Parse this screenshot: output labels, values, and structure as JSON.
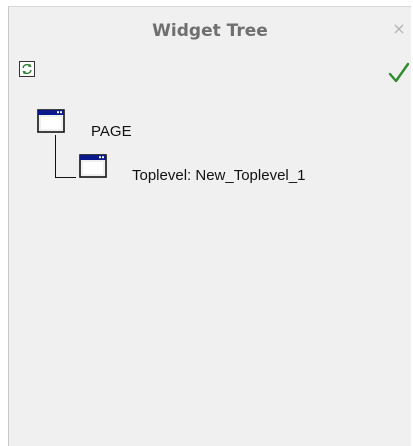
{
  "window": {
    "title": "Widget Tree",
    "close_glyph": "×"
  },
  "toolbar": {
    "refresh_icon": "refresh-icon",
    "apply_icon": "checkmark-icon",
    "apply_color": "#2e8b2e"
  },
  "tree": {
    "nodes": [
      {
        "label": "PAGE",
        "icon": "window-icon",
        "level": 0
      },
      {
        "label": "Toplevel: New_Toplevel_1",
        "icon": "window-icon",
        "level": 1
      }
    ]
  }
}
